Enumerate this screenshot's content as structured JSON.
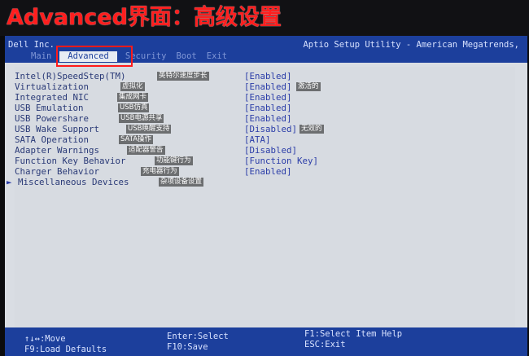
{
  "photo_title": "Advanced界面：高级设置",
  "header": {
    "vendor": "Dell Inc.",
    "product": "Aptio Setup Utility - American Megatrends,"
  },
  "tabs": [
    "Main",
    "Advanced",
    "Security",
    "Boot",
    "Exit"
  ],
  "settings": [
    {
      "label": "Intel(R)SpeedStep(TM)",
      "annotation": "英特尔速度步长",
      "value": "[Enabled]",
      "value_annotation": ""
    },
    {
      "label": "Virtualization",
      "annotation": "虚拟化",
      "value": "[Enabled]",
      "value_annotation": "激活的"
    },
    {
      "label": "Integrated NIC",
      "annotation": "集成网卡",
      "value": "[Enabled]",
      "value_annotation": ""
    },
    {
      "label": "USB Emulation",
      "annotation": "USB仿真",
      "value": "[Enabled]",
      "value_annotation": ""
    },
    {
      "label": "USB Powershare",
      "annotation": "USB电源共享",
      "value": "[Enabled]",
      "value_annotation": ""
    },
    {
      "label": "USB Wake Support",
      "annotation": "USB唤醒支持",
      "value": "[Disabled]",
      "value_annotation": "无效的"
    },
    {
      "label": "SATA Operation",
      "annotation": "SATA操作",
      "value": "[ATA]",
      "value_annotation": ""
    },
    {
      "label": "Adapter Warnings",
      "annotation": "适配器警告",
      "value": "[Disabled]",
      "value_annotation": ""
    },
    {
      "label": "Function Key Behavior",
      "annotation": "功能键行为",
      "value": "[Function Key]",
      "value_annotation": ""
    },
    {
      "label": "Charger Behavior",
      "annotation": "充电器行为",
      "value": "[Enabled]",
      "value_annotation": ""
    },
    {
      "label": "Miscellaneous Devices",
      "annotation": "杂项设备设置",
      "value": "",
      "value_annotation": ""
    }
  ],
  "submenu_arrow": "►",
  "footer": {
    "move": "↑↓↔:Move",
    "load_defaults": "F9:Load Defaults",
    "select": "Enter:Select",
    "save": "F10:Save",
    "help": "F1:Select Item Help",
    "exit": "ESC:Exit"
  },
  "colors": {
    "header_bg": "#1c3f9c",
    "screen_bg": "#d9dde3",
    "highlight_border": "#ff1a1a",
    "title_text": "#ff1e1e"
  }
}
